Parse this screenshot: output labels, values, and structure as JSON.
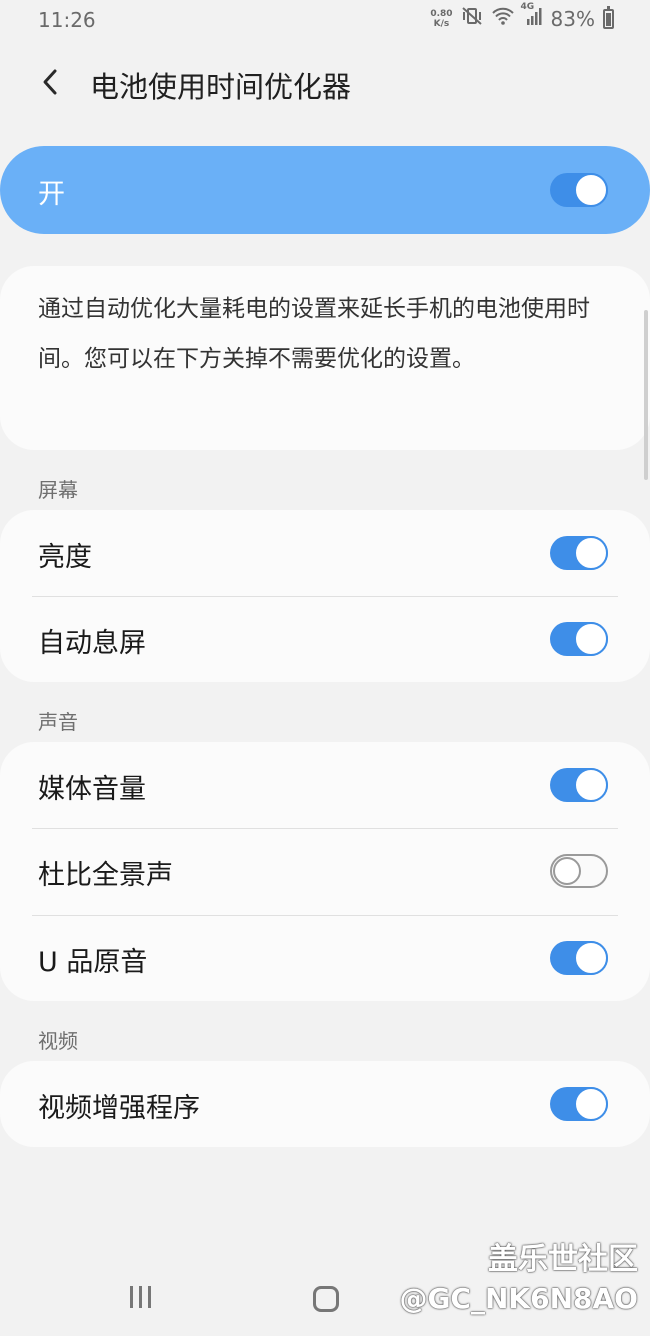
{
  "status_bar": {
    "time": "11:26",
    "net_speed_value": "0.80",
    "net_speed_unit": "K/s",
    "network": "4G",
    "battery": "83%"
  },
  "header": {
    "title": "电池使用时间优化器"
  },
  "master_switch": {
    "label": "开",
    "on": true
  },
  "description": "通过自动优化大量耗电的设置来延长手机的电池使用时间。您可以在下方关掉不需要优化的设置。",
  "sections": [
    {
      "title": "屏幕",
      "items": [
        {
          "label": "亮度",
          "on": true
        },
        {
          "label": "自动息屏",
          "on": true
        }
      ]
    },
    {
      "title": "声音",
      "items": [
        {
          "label": "媒体音量",
          "on": true
        },
        {
          "label": "杜比全景声",
          "on": false
        },
        {
          "label": "U 品原音",
          "on": true
        }
      ]
    },
    {
      "title": "视频",
      "items": [
        {
          "label": "视频增强程序",
          "on": true
        }
      ]
    }
  ],
  "watermark": {
    "line1": "盖乐世社区",
    "line2": "@GC_NK6N8AO"
  },
  "colors": {
    "accent": "#3e8ee8",
    "master_bg": "#6ab0f7",
    "page_bg": "#f2f2f2",
    "card_bg": "#fbfbfb"
  }
}
